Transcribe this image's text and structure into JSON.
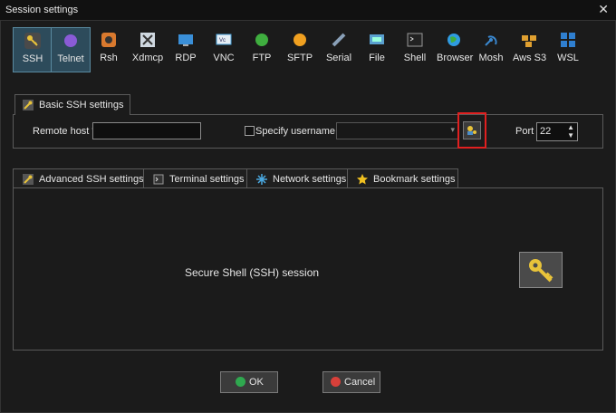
{
  "window": {
    "title": "Session settings",
    "close_glyph": "✕"
  },
  "session_types": [
    {
      "label": "SSH",
      "icon": "key-icon",
      "color": "#e8c33a",
      "selected": true
    },
    {
      "label": "Telnet",
      "icon": "telnet-icon",
      "color": "#8a5bd6"
    },
    {
      "label": "Rsh",
      "icon": "rsh-icon",
      "color": "#d9792e"
    },
    {
      "label": "Xdmcp",
      "icon": "xdmcp-icon",
      "color": "#4a8cc8"
    },
    {
      "label": "RDP",
      "icon": "rdp-icon",
      "color": "#3a8fd8"
    },
    {
      "label": "VNC",
      "icon": "vnc-icon",
      "color": "#4aa0d8"
    },
    {
      "label": "FTP",
      "icon": "ftp-icon",
      "color": "#3fae3f"
    },
    {
      "label": "SFTP",
      "icon": "sftp-icon",
      "color": "#f0a020"
    },
    {
      "label": "Serial",
      "icon": "serial-icon",
      "color": "#8aa0b8"
    },
    {
      "label": "File",
      "icon": "file-icon",
      "color": "#5aa0d0"
    },
    {
      "label": "Shell",
      "icon": "shell-icon",
      "color": "#444444"
    },
    {
      "label": "Browser",
      "icon": "browser-icon",
      "color": "#2f9be0"
    },
    {
      "label": "Mosh",
      "icon": "mosh-icon",
      "color": "#3a88d0"
    },
    {
      "label": "Aws S3",
      "icon": "aws-s3-icon",
      "color": "#e0a030"
    },
    {
      "label": "WSL",
      "icon": "wsl-icon",
      "color": "#2f7fd0"
    }
  ],
  "basic": {
    "tab_label": "Basic SSH settings",
    "remote_host_label": "Remote host *",
    "remote_host_value": "",
    "specify_username_label": "Specify username",
    "specify_username_checked": false,
    "username_value": "",
    "port_label": "Port",
    "port_value": "22"
  },
  "sub_tabs": [
    {
      "label": "Advanced SSH settings",
      "icon": "wrench-icon"
    },
    {
      "label": "Terminal settings",
      "icon": "terminal-icon"
    },
    {
      "label": "Network settings",
      "icon": "network-icon"
    },
    {
      "label": "Bookmark settings",
      "icon": "star-icon"
    }
  ],
  "panel": {
    "description": "Secure Shell (SSH) session"
  },
  "buttons": {
    "ok": "OK",
    "cancel": "Cancel"
  },
  "colors": {
    "accent": "#e8c33a",
    "highlight": "#e02020",
    "ok": "#2fa84f",
    "cancel": "#d8403a"
  }
}
